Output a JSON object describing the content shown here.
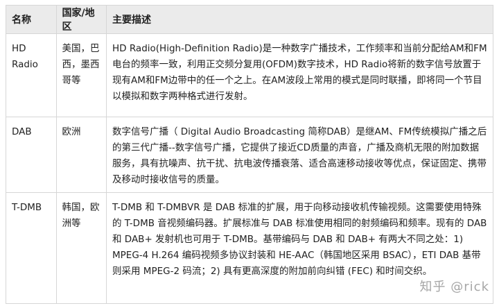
{
  "table": {
    "headers": [
      "名称",
      "国家/地区",
      "主要描述"
    ],
    "rows": [
      {
        "name": "HD Radio",
        "country": "美国，巴西，墨西哥等",
        "description": "HD Radio(High-Definition Radio)是一种数字广播技术，工作频率和当前分配给AM和FM电台的频率一致，利用正交频分复用(OFDM)数字技术，HD Radio将新的数字信号放置于现有AM和FM边带中的任一个之上。在AM波段上常用的模式是同时联播，即将同一个节目以模拟和数字两种格式进行发射。"
      },
      {
        "name": "DAB",
        "country": "欧洲",
        "description": "数字信号广播（ Digital Audio Broadcasting 简称DAB）是继AM、FM传统模拟广播之后的第三代广播--数字信号广播，它提供了接近CD质量的声音，广播及商机无限的附加数据服务，具有抗噪声、抗干扰、抗电波传播衰落、适合高速移动接收等优点，保证固定、携带及移动时接收信号的质量。"
      },
      {
        "name": "T-DMB",
        "country": "韩国，欧洲等",
        "description": "T-DMB 和 T-DMBVR 是 DAB 标准的扩展，用于向移动接收机传输视频。这需要使用特殊的 T-DMB 音视频编码器。扩展标准与 DAB 标准使用相同的射频编码和频率。现有的 DAB 和 DAB+ 发射机也可用于 T-DMB。基带编码与 DAB 和 DAB+ 有两大不同之处：1) MPEG-4 H.264 编码视频多协议封装和 HE-AAC（韩国地区采用 BSAC），ETI DAB 基带则采用 MPEG-2 码流；2) 具有更高深度的附加前向纠错 (FEC) 和时间交织。"
      }
    ]
  },
  "watermark": "知乎 @rick"
}
